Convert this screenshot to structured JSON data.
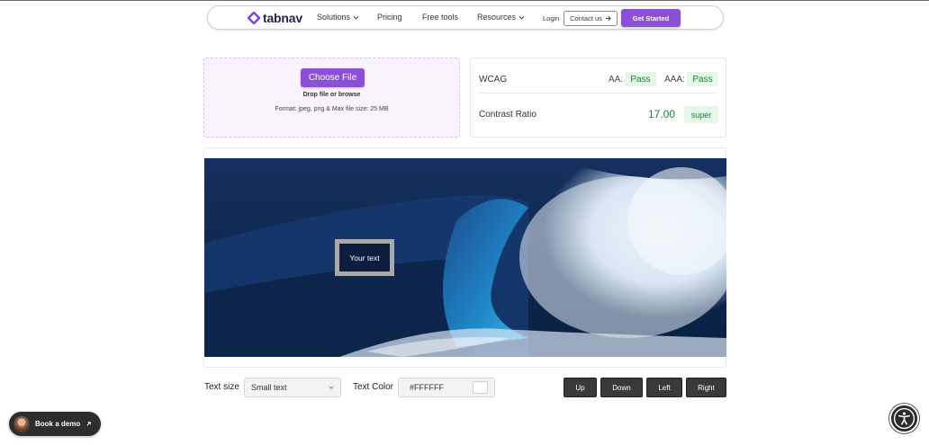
{
  "nav": {
    "logo_text": "tabnav",
    "links": [
      "Solutions",
      "Pricing",
      "Free tools",
      "Resources"
    ],
    "login": "Login",
    "contact": "Contact us",
    "get_started": "Get Started"
  },
  "upload": {
    "button_label": "Choose File",
    "drop_text": "Drop file or browse",
    "format_text": "Format: jpeg, png & Max file size: 25 MB"
  },
  "wcag": {
    "label": "WCAG",
    "aa_label": "AA:",
    "aa_result": "Pass",
    "aaa_label": "AAA:",
    "aaa_result": "Pass",
    "ratio_label": "Contrast Ratio",
    "ratio_value": "17.00",
    "ratio_badge": "super"
  },
  "preview": {
    "overlay_text": "Your text"
  },
  "controls": {
    "text_size_label": "Text size",
    "text_size_value": "Small text",
    "text_color_label": "Text Color",
    "text_color_value": "#FFFFFF",
    "directions": [
      "Up",
      "Down",
      "Left",
      "Right"
    ]
  },
  "floaters": {
    "book_demo": "Book a demo"
  },
  "colors": {
    "brand_purple": "#8b4fd8",
    "pass_green": "#1f7a3a",
    "pass_bg": "#e6f7ea"
  }
}
